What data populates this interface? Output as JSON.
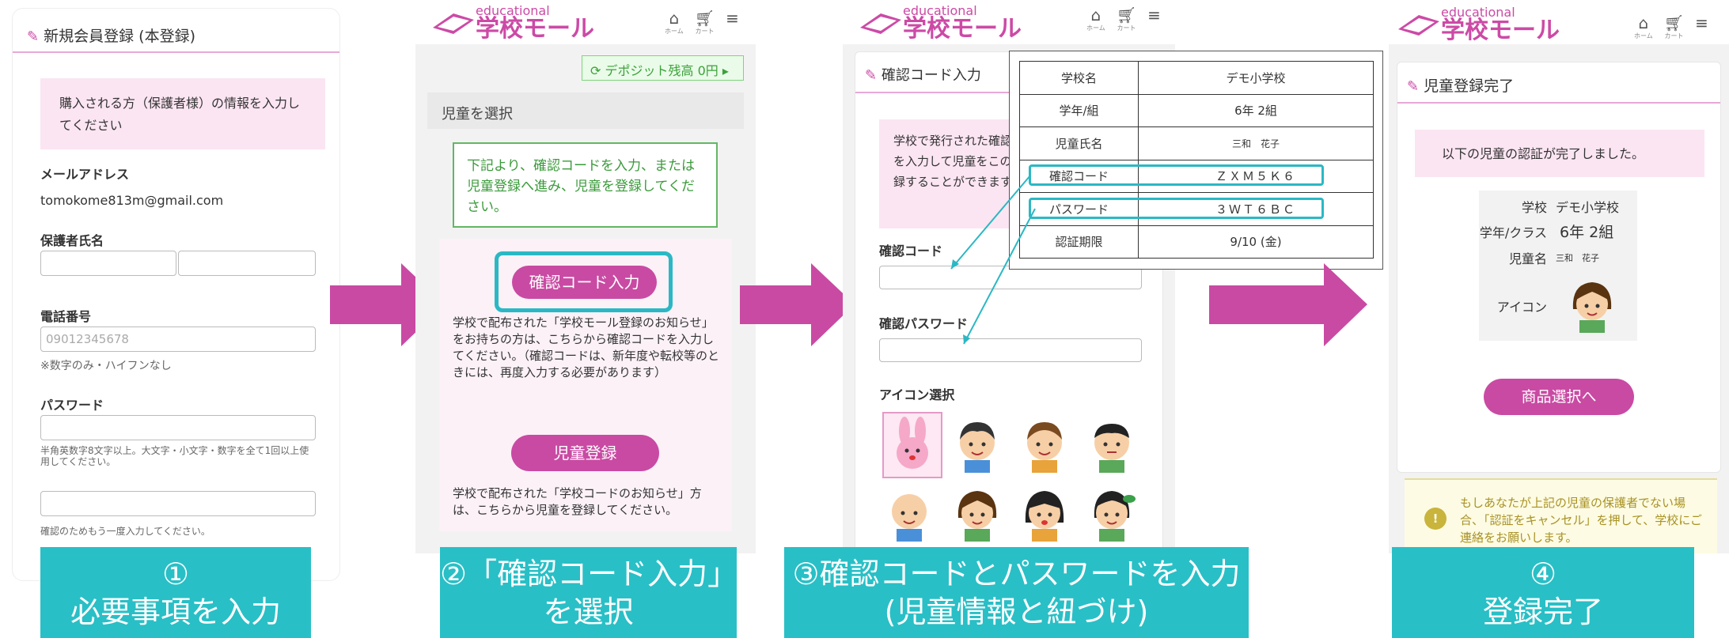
{
  "panel1": {
    "title": "新規会員登録 (本登録)",
    "notice": "購入される方（保護者様）の情報を入力してください",
    "email_label": "メールアドレス",
    "email_value": "tomokome813m@gmail.com",
    "name_label": "保護者氏名",
    "phone_label": "電話番号",
    "phone_placeholder": "09012345678",
    "phone_hint": "※数字のみ・ハイフンなし",
    "password_label": "パスワード",
    "password_hint": "半角英数字8文字以上。大文字・小文字・数字を全て1回以上使用してください。",
    "confirm_hint": "確認のためもう一度入力してください。"
  },
  "panel2": {
    "logo_small": "educational",
    "logo_big": "学校モール",
    "nav_home": "ホーム",
    "nav_cart": "カート",
    "deposit": "デポジット残高 0円",
    "section": "児童を選択",
    "instruction": "下記より、確認コードを入力、または児童登録へ進み、児童を登録してください。",
    "code_button": "確認コード入力",
    "code_text": "学校で配布された「学校モール登録のお知らせ」をお持ちの方は、こちらから確認コードを入力してください。（確認コードは、新年度や転校等のときには、再度入力する必要があります）",
    "register_button": "児童登録",
    "register_text": "学校で配布された「学校コードのお知らせ」方は、こちらから児童を登録してください。"
  },
  "panel3": {
    "logo_small": "educational",
    "logo_big": "学校モール",
    "nav_home": "ホーム",
    "nav_cart": "カート",
    "section": "確認コード入力",
    "notice": "学校で発行された確認コードとパスワードを入力して児童をこの会員アカウントに登録することができます。",
    "code_label": "確認コード",
    "password_label": "確認パスワード",
    "icon_label": "アイコン選択",
    "table": [
      {
        "k": "学校名",
        "v": "デモ小学校"
      },
      {
        "k": "学年/組",
        "v": "6年 2組"
      },
      {
        "k": "児童氏名",
        "v": "三和　花子"
      },
      {
        "k": "確認コード",
        "v": "ＺＸＭ５Ｋ６"
      },
      {
        "k": "パスワード",
        "v": "３ＷＴ６ＢＣ"
      },
      {
        "k": "認証期限",
        "v": "9/10 (金)"
      }
    ]
  },
  "panel4": {
    "logo_small": "educational",
    "logo_big": "学校モール",
    "nav_home": "ホーム",
    "nav_cart": "カート",
    "section": "児童登録完了",
    "message": "以下の児童の認証が完了しました。",
    "rows": [
      {
        "k": "学校",
        "v": "デモ小学校"
      },
      {
        "k": "学年/クラス",
        "v": "6年 2組"
      },
      {
        "k": "児童名",
        "v": "三和　花子"
      },
      {
        "k": "アイコン",
        "v": ""
      }
    ],
    "button": "商品選択へ",
    "warning": "もしあなたが上記の児童の保護者でない場合、「認証をキャンセル」を押して、学校にご連絡をお願いします。"
  },
  "captions": {
    "c1_line1": "①",
    "c1_line2": "必要事項を入力",
    "c2_line1": "②「確認コード入力」",
    "c2_line2": "を選択",
    "c3_line1": "③確認コードとパスワードを入力",
    "c3_line2": "(児童情報と紐づけ)",
    "c4_line1": "④",
    "c4_line2": "登録完了"
  },
  "colors": {
    "accent": "#c94aa3",
    "caption": "#29bfc6",
    "highlight": "#2bb8c4",
    "arrow": "#c94aa3",
    "notice_bg": "#fbe5f2"
  }
}
